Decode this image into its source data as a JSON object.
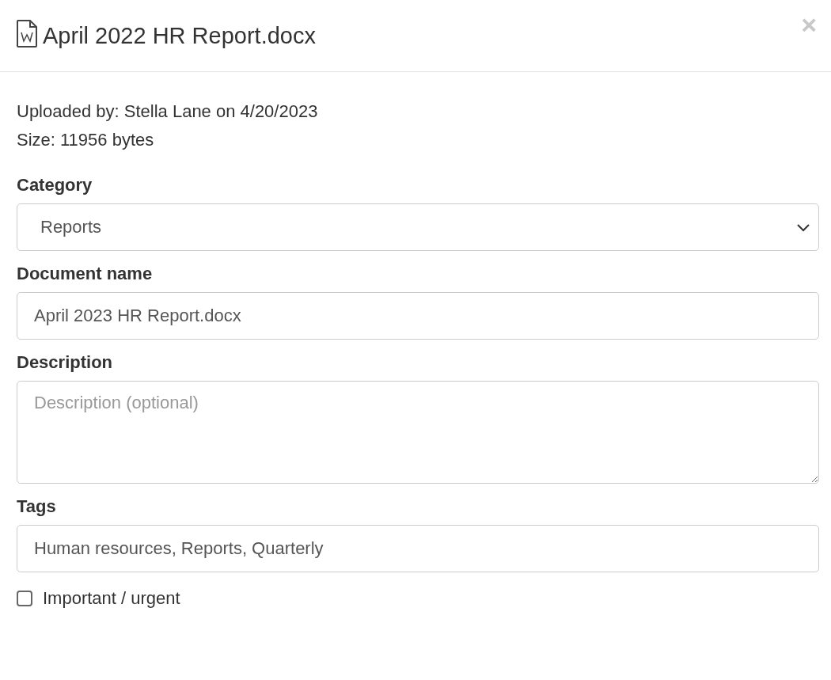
{
  "dialog": {
    "title": "April 2022 HR Report.docx",
    "close": "×"
  },
  "info": [
    "Uploaded by: Stella Lane on 4/20/2023",
    "Size: 11956 bytes"
  ],
  "fields": [
    {
      "kind": "select",
      "label": "Category",
      "value": "Reports"
    },
    {
      "kind": "text",
      "label": "Document name",
      "value": "April 2023 HR Report.docx"
    },
    {
      "kind": "textarea",
      "label": "Description",
      "placeholder": "Description (optional)"
    },
    {
      "kind": "text",
      "label": "Tags",
      "value": "Human resources, Reports, Quarterly"
    }
  ],
  "checkbox": {
    "label": "Important / urgent",
    "checked": false
  }
}
